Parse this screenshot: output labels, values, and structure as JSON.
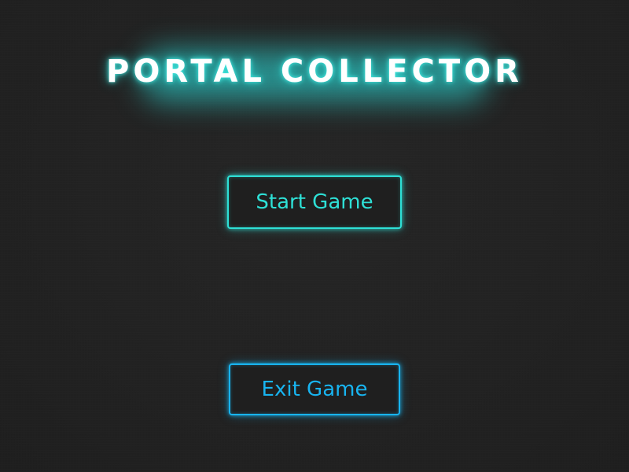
{
  "game": {
    "title": "PORTAL COLLECTOR"
  },
  "menu": {
    "start_label": "Start Game",
    "exit_label": "Exit Game"
  },
  "colors": {
    "background": "#232323",
    "title_glow": "#2de6e1",
    "start_accent": "#2ee0d6",
    "exit_accent": "#18b4f0"
  }
}
